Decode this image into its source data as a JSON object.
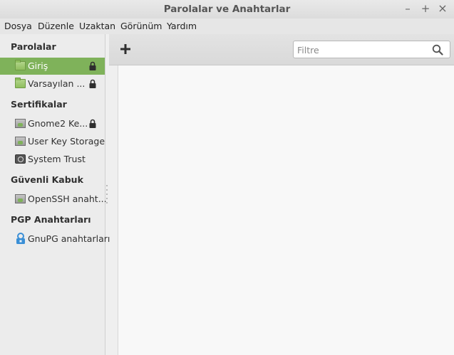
{
  "window": {
    "title": "Parolalar ve Anahtarlar",
    "controls": {
      "minimize": "–",
      "maximize": "+",
      "close": "×"
    }
  },
  "menu": [
    {
      "label": "Dosya"
    },
    {
      "label": "Düzenle"
    },
    {
      "label": "Uzaktan"
    },
    {
      "label": "Görünüm"
    },
    {
      "label": "Yardım"
    }
  ],
  "sidebar": {
    "sections": [
      {
        "title": "Parolalar",
        "items": [
          {
            "label": "Giriş",
            "icon": "folder-icon",
            "locked": true,
            "selected": true
          },
          {
            "label": "Varsayılan ...",
            "icon": "folder-icon",
            "locked": true,
            "selected": false
          }
        ]
      },
      {
        "title": "Sertifikalar",
        "items": [
          {
            "label": "Gnome2 Ke...",
            "icon": "keyring-icon",
            "locked": true
          },
          {
            "label": "User Key Storage",
            "icon": "keyring-icon",
            "locked": false
          },
          {
            "label": "System Trust",
            "icon": "system-trust-icon",
            "locked": false
          }
        ]
      },
      {
        "title": "Güvenli Kabuk",
        "items": [
          {
            "label": "OpenSSH anaht...",
            "icon": "keyring-icon",
            "locked": false
          }
        ]
      },
      {
        "title": "PGP Anahtarları",
        "items": [
          {
            "label": "GnuPG anahtarları",
            "icon": "gnupg-icon",
            "locked": false
          }
        ]
      }
    ]
  },
  "toolbar": {
    "add_icon": "plus-icon",
    "filter": {
      "placeholder": "Filtre",
      "value": "",
      "icon": "search-icon"
    }
  },
  "colors": {
    "selection": "#7fb25a",
    "content_bg": "#f8f8f8"
  }
}
